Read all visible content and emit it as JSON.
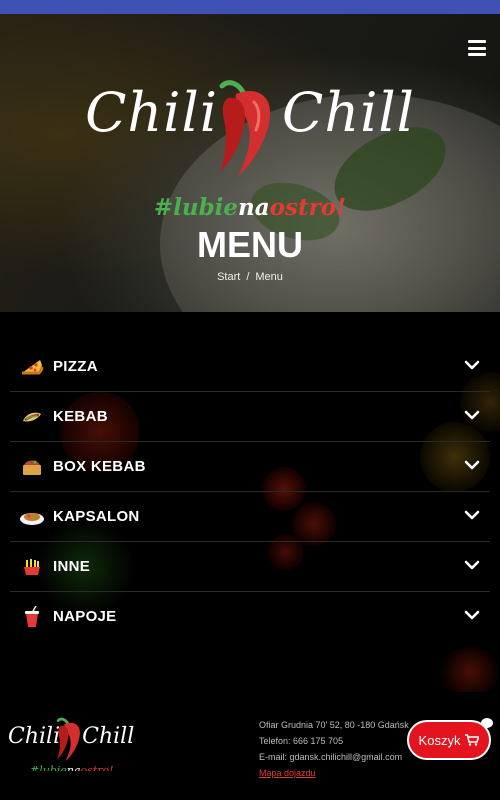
{
  "brand": {
    "name_left": "Chili",
    "name_right": "Chill",
    "tagline_parts": [
      "#lubie",
      "na",
      "ostro!"
    ],
    "accent_green": "#4caf50",
    "accent_red": "#e53935"
  },
  "header": {
    "menu_icon": "hamburger-icon"
  },
  "hero": {
    "title": "MENU",
    "breadcrumb": {
      "home": "Start",
      "separator": "/",
      "current": "Menu"
    }
  },
  "categories": [
    {
      "label": "PIZZA",
      "icon": "pizza-icon"
    },
    {
      "label": "KEBAB",
      "icon": "kebab-icon"
    },
    {
      "label": "BOX KEBAB",
      "icon": "box-kebab-icon"
    },
    {
      "label": "KAPSALON",
      "icon": "kapsalon-icon"
    },
    {
      "label": "INNE",
      "icon": "fries-icon"
    },
    {
      "label": "NAPOJE",
      "icon": "drink-icon"
    }
  ],
  "footer": {
    "address": "Ofiar Grudnia 70' 52, 80 -180 Gdańsk",
    "phone": "Telefon: 666 175 705",
    "email": "E-mail: gdansk.chilichill@gmail.com",
    "map_link": "Mapa dojazdu"
  },
  "cart": {
    "label": "Koszyk",
    "icon": "cart-icon",
    "color": "#e3141d"
  }
}
